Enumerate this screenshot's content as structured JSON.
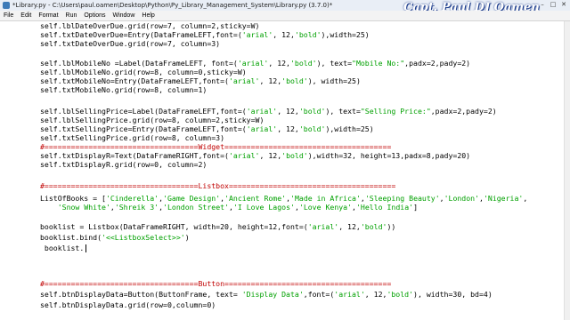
{
  "window": {
    "title": "*Library.py - C:\\Users\\paul.oamen\\Desktop\\Python\\Py_Library_Management_System\\Library.py (3.7.0)*",
    "watermark": "Capt. Paul DJ Oamen",
    "controls": [
      "–",
      "□",
      "✕"
    ]
  },
  "menu": [
    "File",
    "Edit",
    "Format",
    "Run",
    "Options",
    "Window",
    "Help"
  ],
  "code": [
    "self.lblDateOverDue.grid(row=7, column=2,sticky=W)",
    "self.txtDateOverDue=Entry(DataFrameLEFT,font=('arial', 12,'bold'),width=25)",
    "self.txtDateOverDue.grid(row=7, column=3)",
    "",
    "self.lblMobileNo =Label(DataFrameLEFT, font=('arial', 12,'bold'), text=\"Mobile No:\",padx=2,pady=2)",
    "self.lblMobileNo.grid(row=8, column=0,sticky=W)",
    "self.txtMobileNo=Entry(DataFrameLEFT,font=('arial', 12,'bold'), width=25)",
    "self.txtMobileNo.grid(row=8, column=1)",
    "",
    "self.lblSellingPrice=Label(DataFrameLEFT,font=('arial', 12,'bold'), text=\"Selling Price:\",padx=2,pady=2)",
    "self.lblSellingPrice.grid(row=8, column=2,sticky=W)",
    "self.txtSellingPrice=Entry(DataFrameLEFT,font=('arial', 12,'bold'),width=25)",
    "self.txtSellingPrice.grid(row=8, column=3)",
    "#===================================Widget======================================",
    "self.txtDisplayR=Text(DataFrameRIGHT,font=('arial', 12,'bold'),width=32, height=13,padx=8,pady=20)",
    "self.txtDisplayR.grid(row=0, column=2)",
    "",
    "#===================================Listbox======================================",
    "ListOfBooks = ['Cinderella','Game Design','Ancient Rome','Made in Africa','Sleeping Beauty','London','Nigeria',",
    "    'Snow White','Shreik 3','London Street','I Love Lagos','Love Kenya','Hello India']",
    "",
    "booklist = Listbox(DataFrameRIGHT, width=20, height=12,font=('arial', 12,'bold'))",
    "booklist.bind('<<ListboxSelect>>')",
    " booklist.",
    "",
    "",
    "#===================================Button======================================",
    "self.btnDisplayData=Button(ButtonFrame, text= 'Display Data',font=('arial', 12,'bold'), width=30, bd=4)",
    "self.btnDisplayData.grid(row=0,column=0)"
  ]
}
